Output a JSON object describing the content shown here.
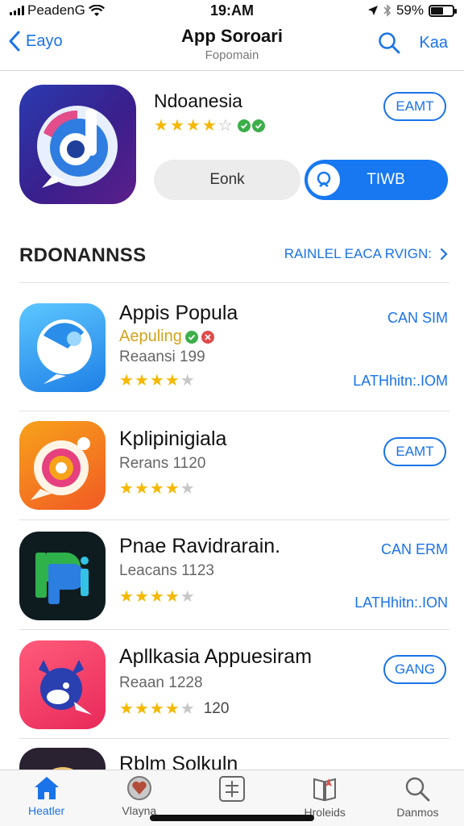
{
  "status_bar": {
    "carrier": "PeadenG",
    "time": "19:AM",
    "battery_percent": "59%",
    "battery_level": 0.59
  },
  "nav": {
    "back_label": "Eayo",
    "title": "App Soroari",
    "subtitle": "Fopomain",
    "right_label": "Kaa"
  },
  "featured": {
    "name": "Ndoanesia",
    "rating": 4,
    "get_label": "EAMT",
    "secondary_label": "Eonk",
    "primary_label": "TIWB"
  },
  "section": {
    "title": "RDONANNSS",
    "link_label": "RAINLEL EACA RVIGN:"
  },
  "apps": [
    {
      "title": "Appis Popula",
      "subtitle": "Aepuling",
      "meta": "Reaansi 199",
      "rating": 4,
      "action_top": "CAN SIM",
      "action_bottom": "LATHhitn:.IOM"
    },
    {
      "title": "Kplipinigiala",
      "meta": "Rerans 1120",
      "rating": 4,
      "action_button": "EAMT"
    },
    {
      "title": "Pnae Ravidrarain.",
      "meta": "Leacans 1123",
      "rating": 4,
      "action_top": "CAN ERM",
      "action_bottom": "LATHhitn:.ION"
    },
    {
      "title": "Apllkasia Appuesiram",
      "meta": "Reaan 1228",
      "rating": 4,
      "rating_count": "120",
      "action_button": "GANG"
    },
    {
      "title": "Rblm Solkuln"
    }
  ],
  "tabs": [
    {
      "label": "Heatler",
      "icon": "home-icon",
      "active": true
    },
    {
      "label": "Vlayna",
      "icon": "heart-badge-icon"
    },
    {
      "label": "",
      "icon": "grid-icon"
    },
    {
      "label": "Hroleids",
      "icon": "book-icon"
    },
    {
      "label": "Danmos",
      "icon": "search-icon"
    }
  ],
  "colors": {
    "accent": "#1a73e8",
    "star": "#f5b800",
    "primary_button": "#1778f2"
  }
}
